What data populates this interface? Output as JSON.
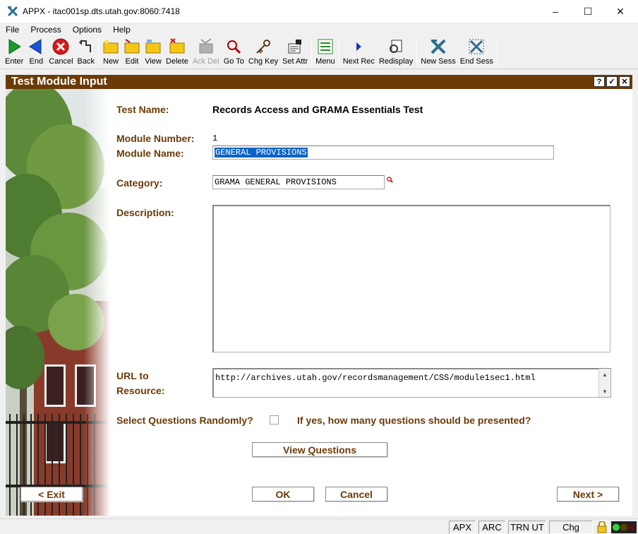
{
  "window": {
    "title": "APPX - itac001sp.dts.utah.gov:8060:7418",
    "minimize": "–",
    "maximize": "☐",
    "close": "✕"
  },
  "menu": [
    "File",
    "Process",
    "Options",
    "Help"
  ],
  "toolbar": [
    {
      "label": "Enter",
      "icon": "enter-arrow-icon",
      "enabled": true
    },
    {
      "label": "End",
      "icon": "end-arrow-icon",
      "enabled": true
    },
    {
      "label": "Cancel",
      "icon": "cancel-icon",
      "enabled": true
    },
    {
      "label": "Back",
      "icon": "back-icon",
      "enabled": true
    },
    {
      "label": "New",
      "icon": "new-folder-icon",
      "enabled": true
    },
    {
      "label": "Edit",
      "icon": "edit-folder-icon",
      "enabled": true
    },
    {
      "label": "View",
      "icon": "view-folder-icon",
      "enabled": true
    },
    {
      "label": "Delete",
      "icon": "delete-folder-icon",
      "enabled": true
    },
    {
      "label": "Ack Del",
      "icon": "ack-delete-icon",
      "enabled": false
    },
    {
      "label": "Go To",
      "icon": "magnifier-icon",
      "enabled": true
    },
    {
      "label": "Chg Key",
      "icon": "key-icon",
      "enabled": true
    },
    {
      "label": "Set Attr",
      "icon": "set-attr-icon",
      "enabled": true
    },
    {
      "label": "Menu",
      "icon": "menu-list-icon",
      "enabled": true
    },
    {
      "label": "Next Rec",
      "icon": "next-record-icon",
      "enabled": true
    },
    {
      "label": "Redisplay",
      "icon": "redisplay-icon",
      "enabled": true
    },
    {
      "label": "New Sess",
      "icon": "new-session-icon",
      "enabled": true
    },
    {
      "label": "End Sess",
      "icon": "end-session-icon",
      "enabled": true
    }
  ],
  "form": {
    "title": "Test Module Input",
    "header_buttons": [
      "?",
      "✓",
      "✕"
    ],
    "test_name_label": "Test Name:",
    "test_name_value": "Records Access and GRAMA Essentials Test",
    "module_number_label": "Module Number:",
    "module_number_value": "1",
    "module_name_label": "Module Name:",
    "module_name_value": "GENERAL PROVISIONS",
    "category_label": "Category:",
    "category_value": "GRAMA GENERAL PROVISIONS",
    "description_label": "Description:",
    "description_value": "",
    "url_label_line1": "URL to",
    "url_label_line2": "Resource:",
    "url_value": "http://archives.utah.gov/recordsmanagement/CSS/module1sec1.html",
    "random_label": "Select Questions Randomly?",
    "random_checked": false,
    "how_many_label": "If yes, how many questions should be presented?",
    "view_questions_button": {
      "prefix": "View ",
      "accel": "Q",
      "suffix": "uestions"
    },
    "exit_button": "< Exit",
    "ok_button": "OK",
    "cancel_button": "Cancel",
    "next_button": "Next >"
  },
  "status": {
    "apx": "APX",
    "arc": "ARC",
    "trn": "TRN UT",
    "mode": "Chg"
  }
}
